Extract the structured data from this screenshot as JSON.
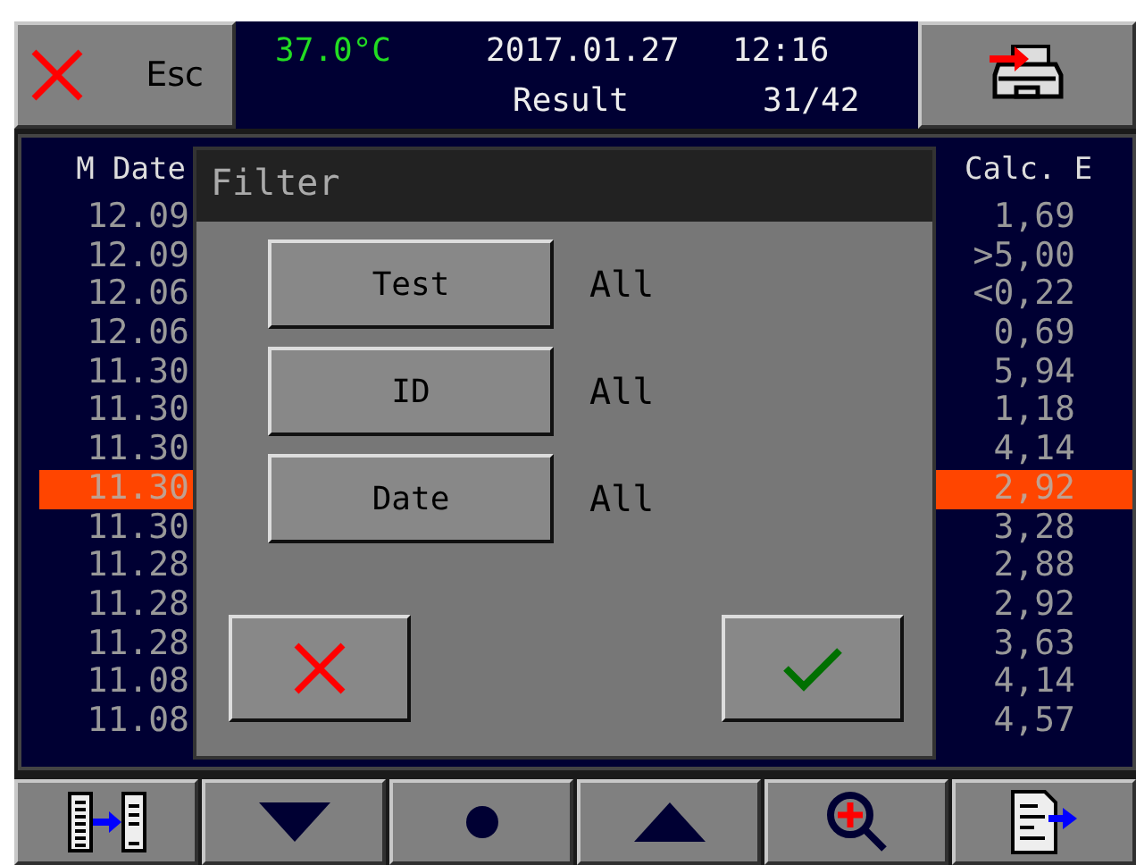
{
  "header": {
    "esc_button": {
      "label": "Esc"
    },
    "temperature": "37.0°C",
    "date": "2017.01.27",
    "time": "12:16",
    "mode": "Result",
    "counter": "31/42"
  },
  "table": {
    "columns": [
      "M Date",
      "Calc. E"
    ],
    "rows": [
      {
        "date": "12.09",
        "calc": "1,69",
        "selected": false
      },
      {
        "date": "12.09",
        "calc": ">5,00",
        "selected": false
      },
      {
        "date": "12.06",
        "calc": "<0,22",
        "selected": false
      },
      {
        "date": "12.06",
        "calc": "0,69",
        "selected": false
      },
      {
        "date": "11.30",
        "calc": "5,94",
        "selected": false
      },
      {
        "date": "11.30",
        "calc": "1,18",
        "selected": false
      },
      {
        "date": "11.30",
        "calc": "4,14",
        "selected": false
      },
      {
        "date": "11.30",
        "calc": "2,92",
        "selected": true
      },
      {
        "date": "11.30",
        "calc": "3,28",
        "selected": false
      },
      {
        "date": "11.28",
        "calc": "2,88",
        "selected": false
      },
      {
        "date": "11.28",
        "calc": "2,92",
        "selected": false
      },
      {
        "date": "11.28",
        "calc": "3,63",
        "selected": false
      },
      {
        "date": "11.08",
        "calc": "4,14",
        "selected": false
      },
      {
        "date": "11.08",
        "calc": "4,57",
        "selected": false
      }
    ]
  },
  "dialog": {
    "title": "Filter",
    "filters": [
      {
        "label": "Test",
        "value": "All"
      },
      {
        "label": "ID",
        "value": "All"
      },
      {
        "label": "Date",
        "value": "All"
      }
    ]
  },
  "toolbar": [
    {
      "kind": "columns"
    },
    {
      "kind": "down"
    },
    {
      "kind": "dot"
    },
    {
      "kind": "up"
    },
    {
      "kind": "zoom"
    },
    {
      "kind": "export"
    }
  ]
}
